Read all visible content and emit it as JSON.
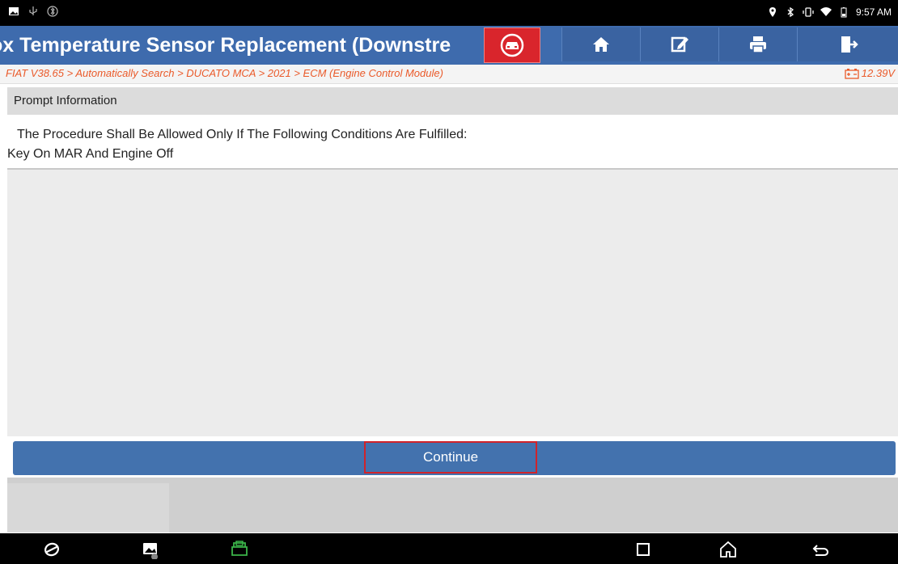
{
  "status_bar": {
    "left_icons": [
      "gallery-icon",
      "usb-icon",
      "bluetooth-scan-icon"
    ],
    "right_icons": [
      "location-icon",
      "bluetooth-icon",
      "vibrate-icon",
      "wifi-icon",
      "battery-icon"
    ],
    "time": "9:57 AM"
  },
  "header": {
    "title": "ox Temperature Sensor Replacement (Downstre",
    "buttons": [
      "car-icon",
      "home-icon",
      "edit-icon",
      "print-icon",
      "exit-icon"
    ]
  },
  "breadcrumb": {
    "path": "FIAT V38.65 > Automatically Search > DUCATO MCA > 2021 > ECM (Engine Control Module)",
    "voltage": "12.39V"
  },
  "prompt": {
    "header": "Prompt Information",
    "line1": "The Procedure Shall Be Allowed Only If The Following Conditions Are Fulfilled:",
    "line2": "Key On MAR And Engine Off"
  },
  "actions": {
    "continue_label": "Continue"
  },
  "nav_bar": {
    "icons": [
      "browser-icon",
      "gallery-icon",
      "vci-icon",
      "recents-icon",
      "home-icon",
      "back-icon"
    ]
  },
  "colors": {
    "title_bar": "#3e6bad",
    "accent_red": "#d9252c",
    "breadcrumb_text": "#ea5a2a"
  }
}
